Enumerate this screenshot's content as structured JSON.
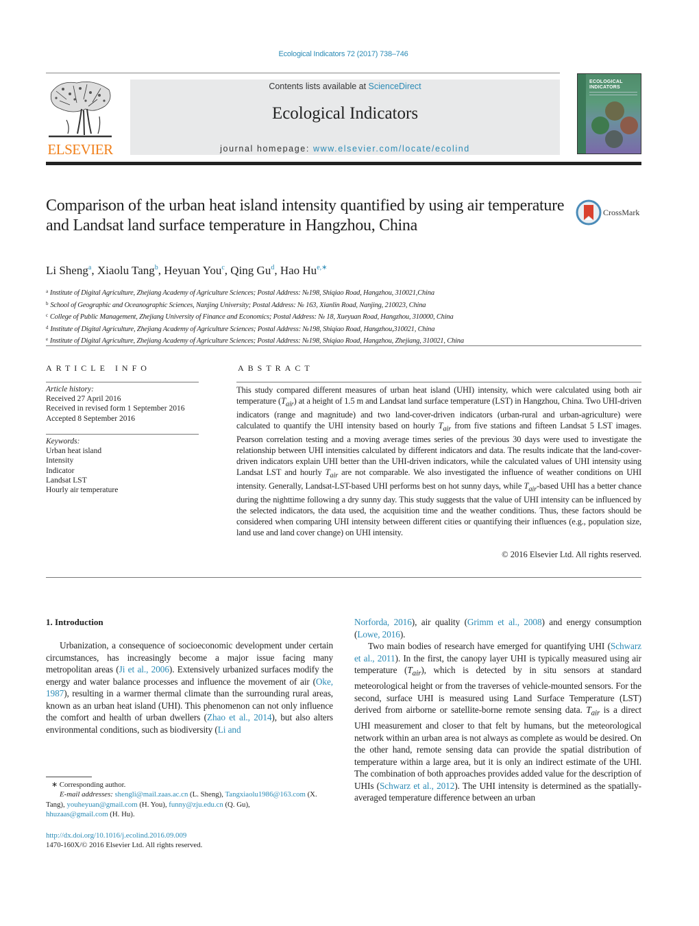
{
  "header": {
    "journal_ref": "Ecological Indicators 72 (2017) 738–746",
    "contents_prefix": "Contents lists available at ",
    "contents_link": "ScienceDirect",
    "journal_name": "Ecological Indicators",
    "homepage_prefix": "journal homepage: ",
    "homepage_link": "www.elsevier.com/locate/ecolind",
    "publisher_logo_text": "ELSEVIER",
    "cover_title_line1": "ECOLOGICAL",
    "cover_title_line2": "INDICATORS",
    "colors": {
      "link": "#2a8ab5",
      "elsevier_orange": "#f07f19",
      "masthead_bg": "#e8e9ea"
    }
  },
  "article": {
    "title": "Comparison of the urban heat island intensity quantified by using air temperature and Landsat land surface temperature in Hangzhou, China",
    "crossmark_label": "CrossMark",
    "authors": [
      {
        "name": "Li Sheng",
        "sup": "a",
        "sep": ", "
      },
      {
        "name": "Xiaolu Tang",
        "sup": "b",
        "sep": ", "
      },
      {
        "name": "Heyuan You",
        "sup": "c",
        "sep": ", "
      },
      {
        "name": "Qing Gu",
        "sup": "d",
        "sep": ", "
      },
      {
        "name": "Hao Hu",
        "sup": "e,∗",
        "sep": ""
      }
    ],
    "affiliations": [
      {
        "key": "a",
        "text": "Institute of Digital Agriculture, Zhejiang Academy of Agriculture Sciences; Postal Address: №198, Shiqiao Road, Hangzhou, 310021,China"
      },
      {
        "key": "b",
        "text": "School of Geographic and Oceanographic Sciences, Nanjing University; Postal Address: № 163, Xianlin Road, Nanjing, 210023, China"
      },
      {
        "key": "c",
        "text": "College of Public Management, Zhejiang University of Finance and Economics; Postal Address: № 18, Xueyuan Road, Hangzhou, 310000, China"
      },
      {
        "key": "d",
        "text": "Institute of Digital Agriculture, Zhejiang Academy of Agriculture Sciences; Postal Address: №198, Shiqiao Road, Hangzhou,310021, China"
      },
      {
        "key": "e",
        "text": "Institute of Digital Agriculture, Zhejiang Academy of Agriculture Sciences; Postal Address: №198, Shiqiao Road, Hangzhou, Zhejiang, 310021, China"
      }
    ]
  },
  "article_info": {
    "heading": "ARTICLE INFO",
    "history_label": "Article history:",
    "history": [
      "Received 27 April 2016",
      "Received in revised form 1 September 2016",
      "Accepted 8 September 2016"
    ],
    "keywords_label": "Keywords:",
    "keywords": [
      "Urban heat island",
      "Intensity",
      "Indicator",
      "Landsat LST",
      "Hourly air temperature"
    ]
  },
  "abstract": {
    "heading": "ABSTRACT",
    "segments": [
      "This study compared different measures of urban heat island (UHI) intensity, which were calculated using both air temperature (",
      "T",
      "air",
      ") at a height of 1.5 m and Landsat land surface temperature (LST) in Hangzhou, China. Two UHI-driven indicators (range and magnitude) and two land-cover-driven indicators (urban-rural and urban-agriculture) were calculated to quantify the UHI intensity based on hourly ",
      "T",
      "air",
      " from five stations and fifteen Landsat 5 LST images. Pearson correlation testing and a moving average times series of the previous 30 days were used to investigate the relationship between UHI intensities calculated by different indicators and data. The results indicate that the land-cover-driven indicators explain UHI better than the UHI-driven indicators, while the calculated values of UHI intensity using Landsat LST and hourly ",
      "T",
      "air",
      " are not comparable. We also investigated the influence of weather conditions on UHI intensity. Generally, Landsat-LST-based UHI performs best on hot sunny days, while ",
      "T",
      "air",
      "-based UHI has a better chance during the nighttime following a dry sunny day. This study suggests that the value of UHI intensity can be influenced by the selected indicators, the data used, the acquisition time and the weather conditions. Thus, these factors should be considered when comparing UHI intensity between different cities or quantifying their influences (e.g., population size, land use and land cover change) on UHI intensity."
    ],
    "copyright": "© 2016 Elsevier Ltd. All rights reserved."
  },
  "body": {
    "section_title": "1.  Introduction",
    "left_p1": [
      "Urbanization, a consequence of socioeconomic development under certain circumstances, has increasingly become a major issue facing many metropolitan areas (",
      "Ji et al., 2006",
      "). Extensively urbanized surfaces modify the energy and water balance processes and influence the movement of air (",
      "Oke, 1987",
      "), resulting in a warmer thermal climate than the surrounding rural areas, known as an urban heat island (UHI). This phenomenon can not only influence the comfort and health of urban dwellers (",
      "Zhao et al., 2014",
      "), but also alters environmental conditions, such as biodiversity (",
      "Li and"
    ],
    "right_p1": [
      "Norforda, 2016",
      "), air quality (",
      "Grimm et al., 2008",
      ") and energy consumption (",
      "Lowe, 2016",
      ")."
    ],
    "right_p2": [
      "Two main bodies of research have emerged for quantifying UHI (",
      "Schwarz et al., 2011",
      "). In the first, the canopy layer UHI is typically measured using air temperature (",
      "T",
      "air",
      "), which is detected by in situ sensors at standard meteorological height or from the traverses of vehicle-mounted sensors. For the second, surface UHI is measured using Land Surface Temperature (LST) derived from airborne or satellite-borne remote sensing data. ",
      "T",
      "air",
      " is a direct UHI measurement and closer to that felt by humans, but the meteorological network within an urban area is not always as complete as would be desired. On the other hand, remote sensing data can provide the spatial distribution of temperature within a large area, but it is only an indirect estimate of the UHI. The combination of both approaches provides added value for the description of UHIs (",
      "Schwarz et al., 2012",
      "). The UHI intensity is determined as the spatially-averaged temperature difference between an urban"
    ]
  },
  "footnotes": {
    "corresponding": "∗  Corresponding author.",
    "email_label": "E-mail addresses:",
    "emails": [
      {
        "addr": "shengli@mail.zaas.ac.cn",
        "who": " (L. Sheng), "
      },
      {
        "addr": "Tangxiaolu1986@163.com",
        "who": " (X. Tang), "
      },
      {
        "addr": "youheyuan@gmail.com",
        "who": " (H. You), "
      },
      {
        "addr": "funny@zju.edu.cn",
        "who": " (Q. Gu), "
      },
      {
        "addr": "hhuzaas@gmail.com",
        "who": " (H. Hu)."
      }
    ],
    "doi": "http://dx.doi.org/10.1016/j.ecolind.2016.09.009",
    "issn_line": "1470-160X/© 2016 Elsevier Ltd. All rights reserved."
  }
}
